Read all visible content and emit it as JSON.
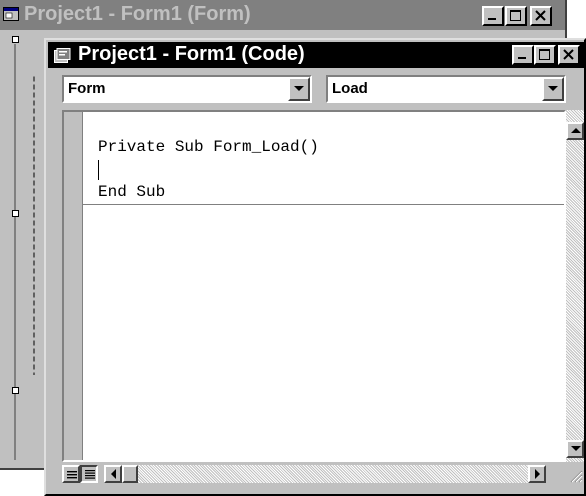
{
  "back_window": {
    "title": "Project1 - Form1 (Form)",
    "icon": "form-window-icon",
    "controls": [
      "minimize-icon",
      "maximize-icon",
      "close-icon"
    ]
  },
  "code_window": {
    "title": "Project1 - Form1 (Code)",
    "icon": "code-window-icon",
    "controls": [
      "minimize-icon",
      "maximize-icon",
      "close-icon"
    ],
    "object_combo": {
      "selected": "Form"
    },
    "procedure_combo": {
      "selected": "Load"
    },
    "code_lines": [
      "Private Sub Form_Load()",
      "",
      "End Sub"
    ],
    "view_buttons": [
      "procedure-view-icon",
      "full-module-view-icon"
    ]
  },
  "colors": {
    "face": "#c0c0c0",
    "active_title": "#000000",
    "inactive_title": "#808080",
    "editor_bg": "#ffffff"
  }
}
